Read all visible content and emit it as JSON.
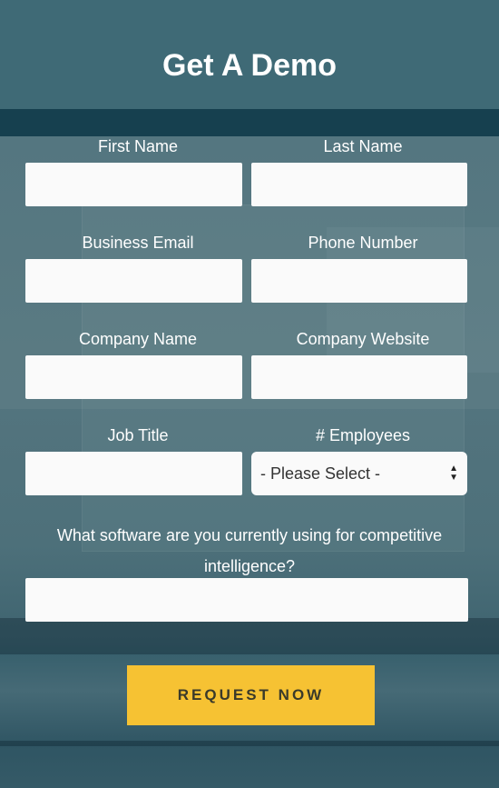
{
  "title": "Get A Demo",
  "fields": {
    "first_name": {
      "label": "First Name",
      "value": ""
    },
    "last_name": {
      "label": "Last Name",
      "value": ""
    },
    "business_email": {
      "label": "Business Email",
      "value": ""
    },
    "phone_number": {
      "label": "Phone Number",
      "value": ""
    },
    "company_name": {
      "label": "Company Name",
      "value": ""
    },
    "company_website": {
      "label": "Company Website",
      "value": ""
    },
    "job_title": {
      "label": "Job Title",
      "value": ""
    },
    "employees": {
      "label": "# Employees",
      "selected": "- Please Select -"
    },
    "software": {
      "label": "What software are you currently using for competitive intelligence?",
      "value": ""
    }
  },
  "submit_label": "REQUEST NOW",
  "colors": {
    "button": "#f6c233",
    "background": "#3d6470",
    "field": "#fafafa"
  }
}
